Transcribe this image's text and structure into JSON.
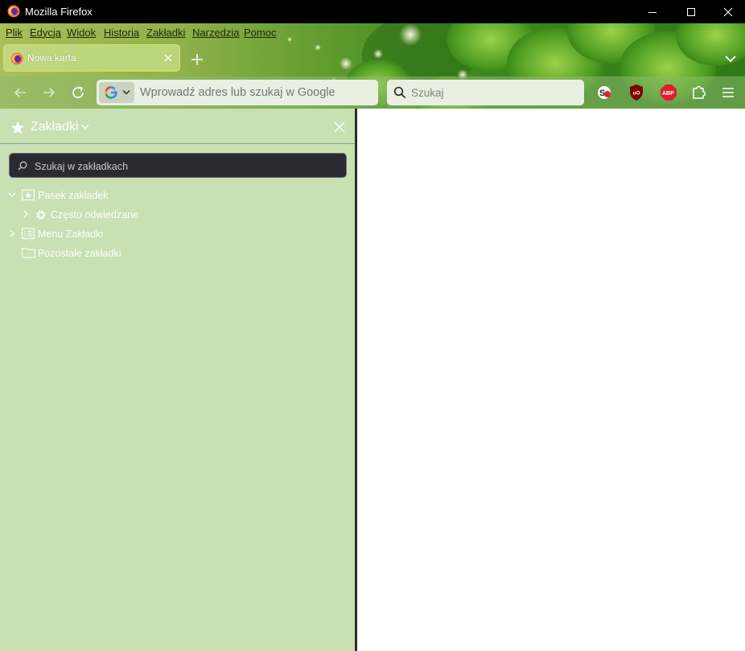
{
  "window": {
    "title": "Mozilla Firefox"
  },
  "menu": [
    "Plik",
    "Edycja",
    "Widok",
    "Historia",
    "Zakładki",
    "Narzędzia",
    "Pomoc"
  ],
  "tab": {
    "label": "Nowa karta"
  },
  "urlbar": {
    "placeholder": "Wprowadź adres lub szukaj w Google"
  },
  "searchbar": {
    "placeholder": "Szukaj"
  },
  "sidebar": {
    "title": "Zakładki",
    "search_placeholder": "Szukaj w zakładkach",
    "tree": [
      {
        "label": "Pasek zakładek",
        "expanded": true
      },
      {
        "label": "Często odwiedzane"
      },
      {
        "label": "Menu Zakładki",
        "expanded": false
      },
      {
        "label": "Pozostałe zakładki"
      }
    ]
  },
  "extensions": [
    {
      "name": "stack-overflow-ext-icon"
    },
    {
      "name": "ublock-origin-icon",
      "badge": "uO"
    },
    {
      "name": "adblock-plus-icon",
      "badge": "ABP"
    },
    {
      "name": "extensions-puzzle-icon"
    }
  ],
  "colors": {
    "sidebar_bg": "#c8e0b2",
    "titlebar_bg": "#000000",
    "tab_border": "#d8e26a"
  }
}
